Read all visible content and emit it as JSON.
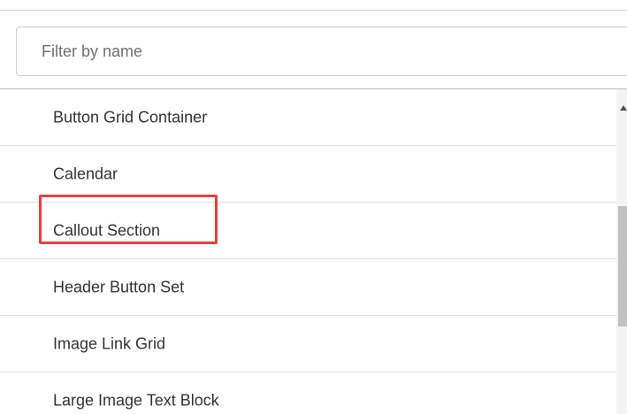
{
  "filter": {
    "placeholder": "Filter by name",
    "value": ""
  },
  "list": {
    "items": [
      {
        "label": "Button Grid Container"
      },
      {
        "label": "Calendar"
      },
      {
        "label": "Callout Section",
        "highlighted": true
      },
      {
        "label": "Header Button Set"
      },
      {
        "label": "Image Link Grid"
      },
      {
        "label": "Large Image Text Block"
      }
    ]
  },
  "highlight": {
    "color": "#e8403f",
    "target": "Callout Section"
  },
  "scrollbar": {
    "up_arrow_icon": "triangle-up-icon"
  }
}
